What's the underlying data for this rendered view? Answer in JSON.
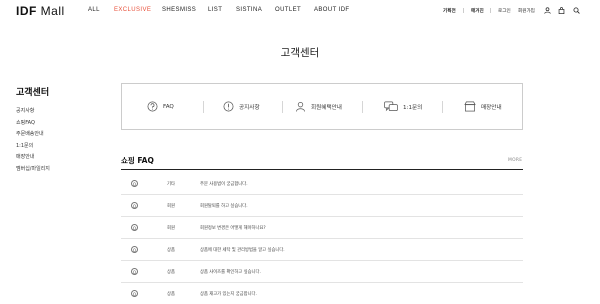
{
  "header": {
    "logo_bold": "IDF",
    "logo_rest": " Mall",
    "nav": [
      {
        "label": "ALL",
        "color": "#222222"
      },
      {
        "label": "EXCLUSIVE",
        "color": "#e8503a"
      },
      {
        "label": "SHESMISS",
        "color": "#222222"
      },
      {
        "label": "LIST",
        "color": "#222222"
      },
      {
        "label": "SISTINA",
        "color": "#222222"
      },
      {
        "label": "OUTLET",
        "color": "#222222"
      },
      {
        "label": "ABOUT IDF",
        "color": "#222222"
      }
    ],
    "util": {
      "brand_story": "기획전",
      "store": "매거진",
      "login": "로그인",
      "join": "회원가입"
    },
    "icons": [
      "user-icon",
      "bag-icon",
      "search-icon"
    ]
  },
  "page_title": "고객센터",
  "sidebar": {
    "title": "고객센터",
    "items": [
      "공지사항",
      "쇼핑FAQ",
      "주문배송안내",
      "1:1문의",
      "매장안내",
      "멤버십/마일리지"
    ]
  },
  "quick_menu": [
    {
      "label": "FAQ",
      "icon": "question-icon"
    },
    {
      "label": "공지사항",
      "icon": "notice-icon"
    },
    {
      "label": "회원혜택안내",
      "icon": "member-icon"
    },
    {
      "label": "1:1문의",
      "icon": "chat-icon"
    },
    {
      "label": "매장안내",
      "icon": "store-icon"
    }
  ],
  "faq": {
    "title": "쇼핑 FAQ",
    "more": "MORE",
    "rows": [
      {
        "mark": "Q",
        "category": "기타",
        "question": "주문 사용법이 궁금합니다."
      },
      {
        "mark": "Q",
        "category": "회원",
        "question": "회원탈퇴를 하고 싶습니다."
      },
      {
        "mark": "Q",
        "category": "회원",
        "question": "회원정보 변경은 어떻게 해야하나요?"
      },
      {
        "mark": "Q",
        "category": "상품",
        "question": "상품에 대한 세탁 및 관리방법을 알고 싶습니다."
      },
      {
        "mark": "Q",
        "category": "상품",
        "question": "상품 사이즈를 확인하고 싶습니다."
      },
      {
        "mark": "Q",
        "category": "상품",
        "question": "상품 재고가 있는지 궁금합니다."
      }
    ]
  }
}
